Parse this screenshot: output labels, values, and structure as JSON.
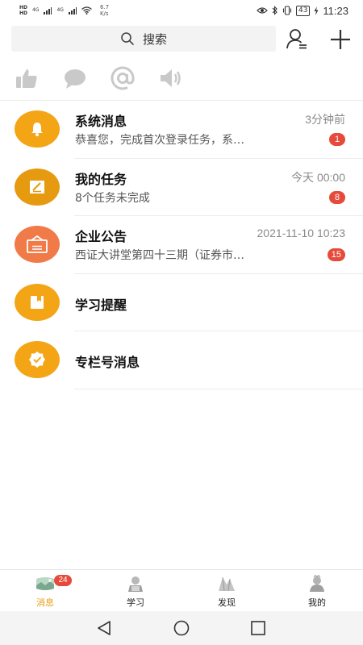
{
  "status_bar": {
    "sim1": "HD",
    "sim2": "HD",
    "net1": "4G",
    "net2": "4G",
    "speed_value": "6.7",
    "speed_unit": "K/s",
    "battery": "43",
    "time": "11:23"
  },
  "search": {
    "placeholder": "搜索"
  },
  "quick_actions": [
    {
      "icon": "thumbs-up-icon"
    },
    {
      "icon": "comment-icon"
    },
    {
      "icon": "at-sign-icon"
    },
    {
      "icon": "speaker-icon"
    }
  ],
  "messages": [
    {
      "title": "系统消息",
      "time": "3分钟前",
      "preview": "恭喜您，完成首次登录任务，系…",
      "badge": "1",
      "icon": "bell-icon",
      "color": "#f3a516"
    },
    {
      "title": "我的任务",
      "time": "今天 00:00",
      "preview": "8个任务未完成",
      "badge": "8",
      "icon": "task-edit-icon",
      "color": "#e69a10"
    },
    {
      "title": "企业公告",
      "time": "2021-11-10 10:23",
      "preview": "西证大讲堂第四十三期（证券市…",
      "badge": "15",
      "icon": "announcement-icon",
      "color": "#f07a48"
    },
    {
      "title": "学习提醒",
      "icon": "notebook-icon",
      "color": "#f3a516"
    },
    {
      "title": "专栏号消息",
      "icon": "verified-badge-icon",
      "color": "#f3a516"
    }
  ],
  "bottom_nav": {
    "items": [
      {
        "label": "消息",
        "icon": "message-tab-icon",
        "badge": "24",
        "active": true
      },
      {
        "label": "学习",
        "icon": "study-tab-icon"
      },
      {
        "label": "发现",
        "icon": "discover-tab-icon"
      },
      {
        "label": "我的",
        "icon": "profile-tab-icon"
      }
    ]
  },
  "colors": {
    "accent": "#e89b10",
    "badge": "#e64a3b",
    "avatar_orange": "#f3a516",
    "avatar_coral": "#f07a48"
  }
}
